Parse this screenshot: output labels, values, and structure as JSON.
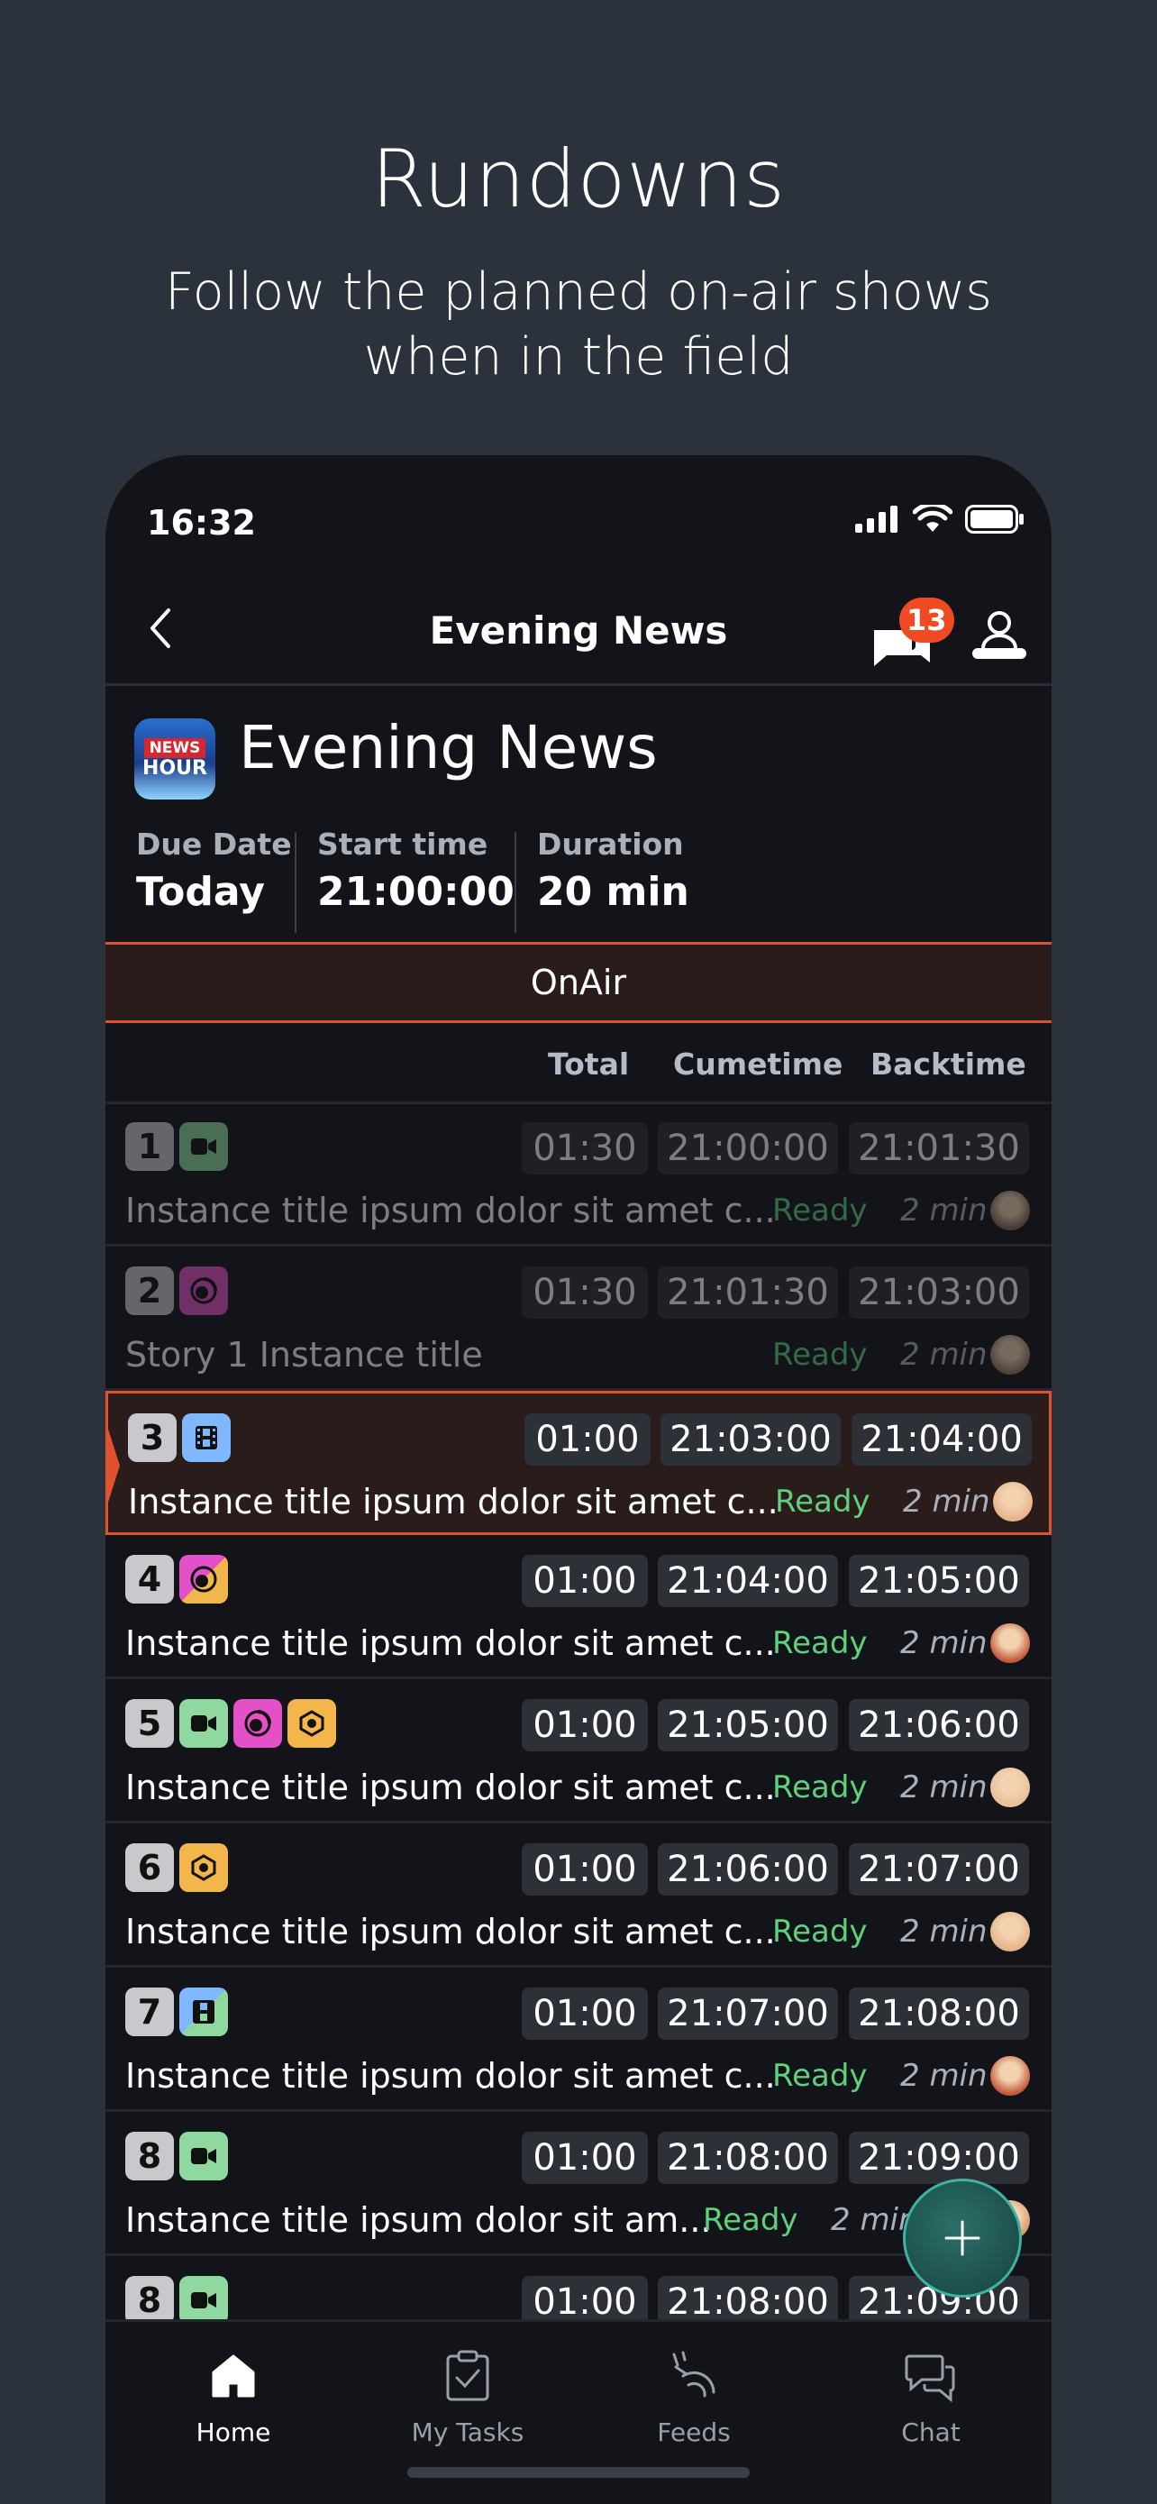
{
  "promo": {
    "title": "Rundowns",
    "subtitle_line1": "Follow the planned on-air shows",
    "subtitle_line2": "when in the field"
  },
  "status_bar": {
    "time": "16:32"
  },
  "nav": {
    "title": "Evening News",
    "message_count": "13"
  },
  "show": {
    "logo_top": "NEWS",
    "logo_bottom": "HOUR",
    "title": "Evening News",
    "due_date_label": "Due Date",
    "due_date_value": "Today",
    "start_time_label": "Start time",
    "start_time_value": "21:00:00",
    "duration_label": "Duration",
    "duration_value": "20 min"
  },
  "onair": {
    "label": "OnAir"
  },
  "columns": {
    "total": "Total",
    "cumetime": "Cumetime",
    "backtime": "Backtime"
  },
  "rows": [
    {
      "num": "1",
      "icons": [
        "camera"
      ],
      "total": "01:30",
      "cume": "21:00:00",
      "back": "21:01:30",
      "title": "Instance title ipsum dolor sit amet c...",
      "status": "Ready",
      "dur": "2 min",
      "state": "played"
    },
    {
      "num": "2",
      "icons": [
        "audio"
      ],
      "total": "01:30",
      "cume": "21:01:30",
      "back": "21:03:00",
      "title": "Story 1 Instance title",
      "status": "Ready",
      "dur": "2 min",
      "state": "played"
    },
    {
      "num": "3",
      "icons": [
        "film"
      ],
      "total": "01:00",
      "cume": "21:03:00",
      "back": "21:04:00",
      "title": "Instance title ipsum dolor sit amet c...",
      "status": "Ready",
      "dur": "2 min",
      "state": "current"
    },
    {
      "num": "4",
      "icons": [
        "audio-graphic"
      ],
      "total": "01:00",
      "cume": "21:04:00",
      "back": "21:05:00",
      "title": "Instance title ipsum dolor sit amet c...",
      "status": "Ready",
      "dur": "2 min",
      "state": "upcoming"
    },
    {
      "num": "5",
      "icons": [
        "camera",
        "audio",
        "graphic"
      ],
      "total": "01:00",
      "cume": "21:05:00",
      "back": "21:06:00",
      "title": "Instance title ipsum dolor sit amet c...",
      "status": "Ready",
      "dur": "2 min",
      "state": "upcoming"
    },
    {
      "num": "6",
      "icons": [
        "graphic"
      ],
      "total": "01:00",
      "cume": "21:06:00",
      "back": "21:07:00",
      "title": "Instance title ipsum dolor sit amet c...",
      "status": "Ready",
      "dur": "2 min",
      "state": "upcoming"
    },
    {
      "num": "7",
      "icons": [
        "film-camera"
      ],
      "total": "01:00",
      "cume": "21:07:00",
      "back": "21:08:00",
      "title": "Instance title ipsum dolor sit amet c...",
      "status": "Ready",
      "dur": "2 min",
      "state": "upcoming"
    },
    {
      "num": "8",
      "icons": [
        "camera"
      ],
      "total": "01:00",
      "cume": "21:08:00",
      "back": "21:09:00",
      "title": "Instance title ipsum dolor sit am...",
      "status": "Ready",
      "dur": "2 min",
      "state": "upcoming"
    },
    {
      "num": "8",
      "icons": [
        "camera"
      ],
      "total": "01:00",
      "cume": "21:08:00",
      "back": "21:09:00",
      "title": "",
      "status": "",
      "dur": "",
      "state": "upcoming"
    }
  ],
  "tabs": [
    {
      "label": "Home",
      "icon": "home-icon",
      "active": true
    },
    {
      "label": "My Tasks",
      "icon": "tasks-icon",
      "active": false
    },
    {
      "label": "Feeds",
      "icon": "feeds-icon",
      "active": false
    },
    {
      "label": "Chat",
      "icon": "chat-icon",
      "active": false
    }
  ],
  "colors": {
    "accent": "#e0512e",
    "ready": "#5fd07c",
    "badge": "#f04a23",
    "fab": "#17423f"
  }
}
